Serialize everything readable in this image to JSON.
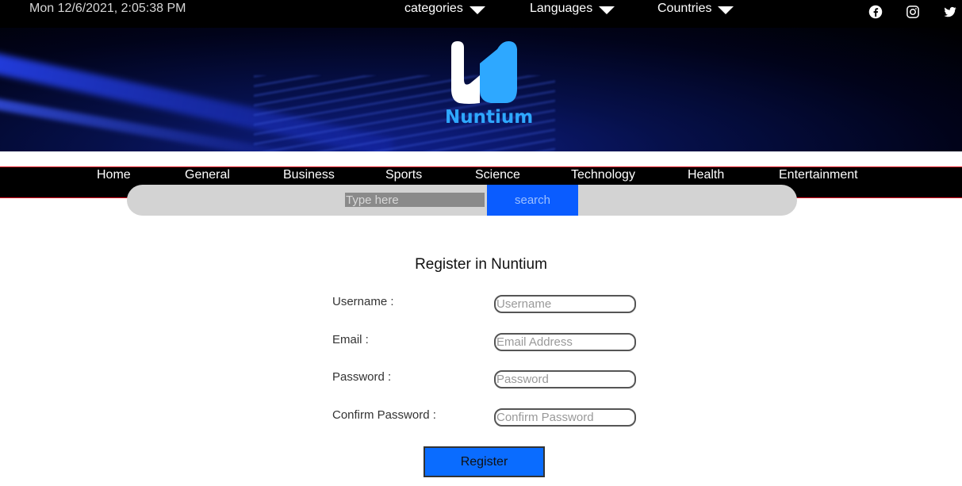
{
  "topbar": {
    "datetime": "Mon 12/6/2021, 2:05:38 PM",
    "dropdowns": [
      {
        "label": "categories",
        "icon": "caret-down-icon"
      },
      {
        "label": "Languages",
        "icon": "caret-down-icon"
      },
      {
        "label": "Countries",
        "icon": "caret-down-icon"
      }
    ],
    "social": [
      "facebook-icon",
      "instagram-icon",
      "twitter-icon"
    ]
  },
  "banner": {
    "logo_text": "Nuntium",
    "logo_colors": {
      "light": "#ffffff",
      "accent": "#2ea8ff"
    }
  },
  "nav": {
    "items": [
      "Home",
      "General",
      "Business",
      "Sports",
      "Science",
      "Technology",
      "Health",
      "Entertainment"
    ],
    "border_color": "#e01020"
  },
  "search": {
    "placeholder": "Type here",
    "button_label": "search",
    "button_color": "#0a5cff"
  },
  "form": {
    "title": "Register in Nuntium",
    "fields": [
      {
        "label": "Username :",
        "placeholder": "Username"
      },
      {
        "label": "Email :",
        "placeholder": "Email Address"
      },
      {
        "label": "Password :",
        "placeholder": "Password"
      },
      {
        "label": "Confirm Password :",
        "placeholder": "Confirm Password"
      }
    ],
    "submit_label": "Register",
    "submit_color": "#0a6cff"
  }
}
